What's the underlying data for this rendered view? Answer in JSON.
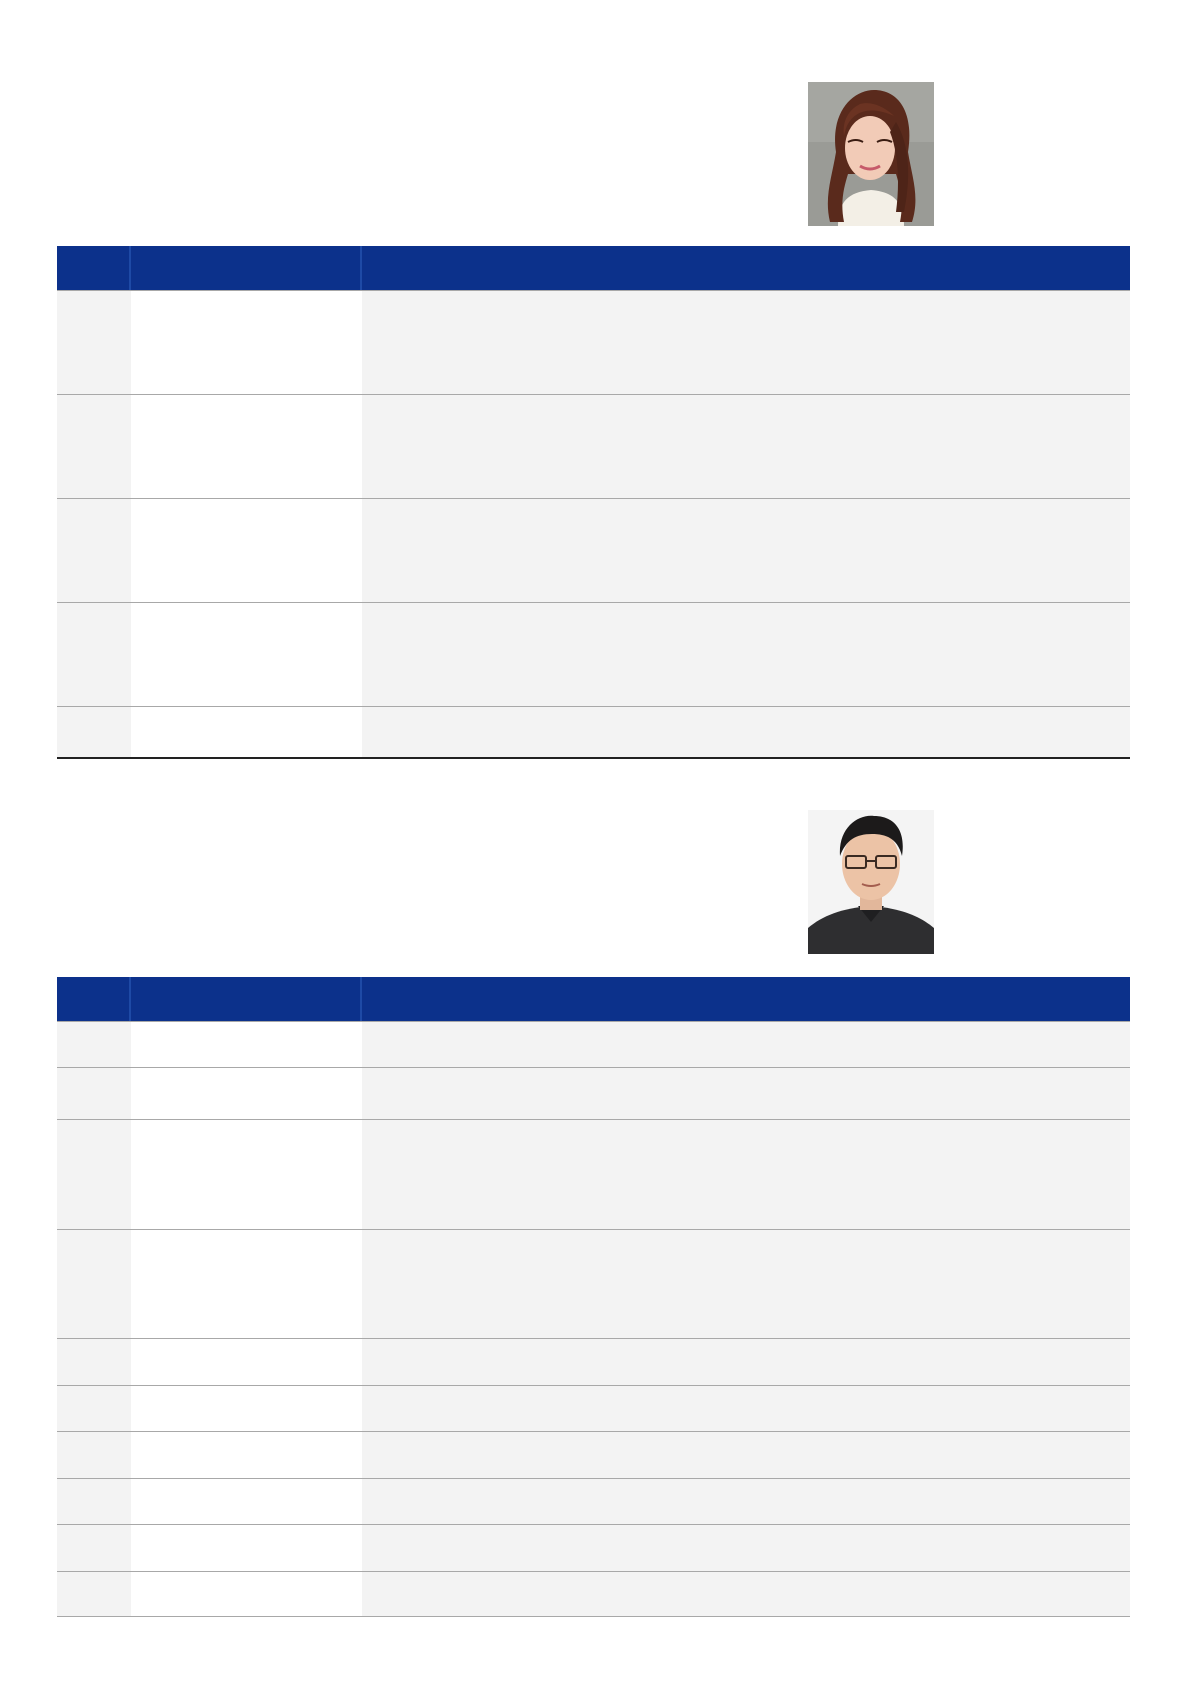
{
  "colors": {
    "header_blue": "#0c318b",
    "row_gray": "#f3f3f3",
    "rule_gray": "#a8a8a8"
  },
  "tables": [
    {
      "photo": "profile-photo-woman",
      "header": [
        "",
        "",
        ""
      ],
      "rows": [
        [
          "",
          "",
          ""
        ],
        [
          "",
          "",
          ""
        ],
        [
          "",
          "",
          ""
        ],
        [
          "",
          "",
          ""
        ],
        [
          "",
          "",
          ""
        ]
      ]
    },
    {
      "photo": "profile-photo-man",
      "header": [
        "",
        "",
        ""
      ],
      "rows": [
        [
          "",
          "",
          ""
        ],
        [
          "",
          "",
          ""
        ],
        [
          "",
          "",
          ""
        ],
        [
          "",
          "",
          ""
        ],
        [
          "",
          "",
          ""
        ],
        [
          "",
          "",
          ""
        ],
        [
          "",
          "",
          ""
        ],
        [
          "",
          "",
          ""
        ],
        [
          "",
          "",
          ""
        ],
        [
          "",
          "",
          ""
        ]
      ]
    }
  ]
}
